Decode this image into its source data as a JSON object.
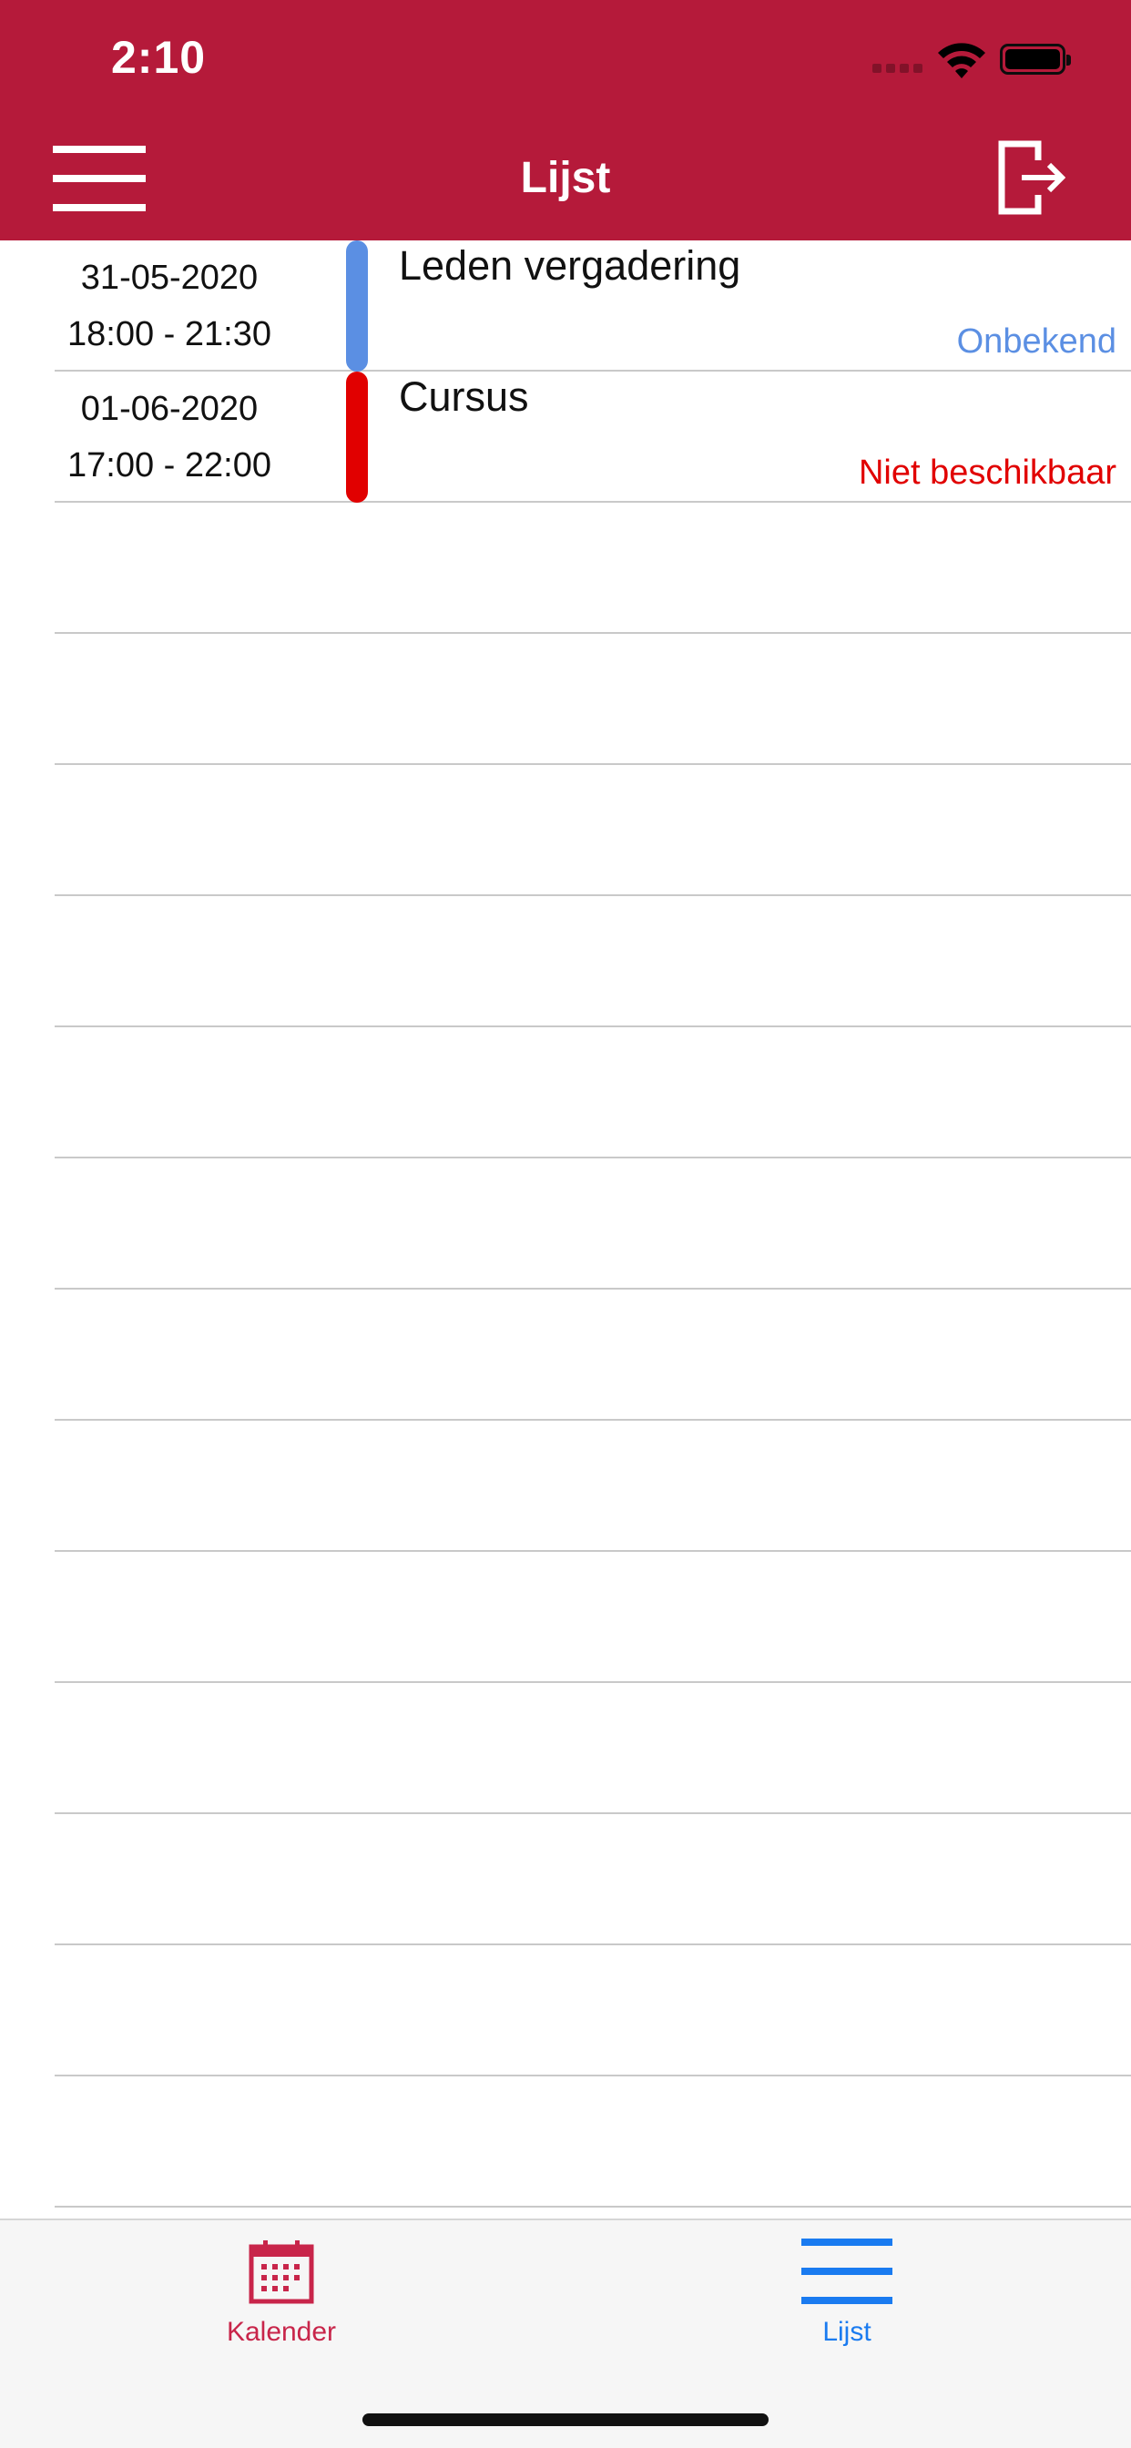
{
  "status_bar": {
    "time": "2:10"
  },
  "header": {
    "title": "Lijst",
    "menu_icon": "hamburger-menu-icon",
    "logout_icon": "logout-icon"
  },
  "colors": {
    "header_bg": "#b51a3a",
    "status_unknown": "#5b8fe3",
    "status_unavailable": "#e10000",
    "tab_active": "#1a7bf0",
    "tab_inactive": "#c8254a"
  },
  "events": [
    {
      "date": "31-05-2020",
      "time": "18:00 - 21:30",
      "title": "Leden vergadering",
      "status": "Onbekend",
      "color": "#5b8fe3"
    },
    {
      "date": "01-06-2020",
      "time": "17:00 - 22:00",
      "title": "Cursus",
      "status": "Niet beschikbaar",
      "color": "#e10000"
    }
  ],
  "tabs": [
    {
      "label": "Kalender",
      "icon": "calendar-icon",
      "active": false
    },
    {
      "label": "Lijst",
      "icon": "list-icon",
      "active": true
    }
  ]
}
